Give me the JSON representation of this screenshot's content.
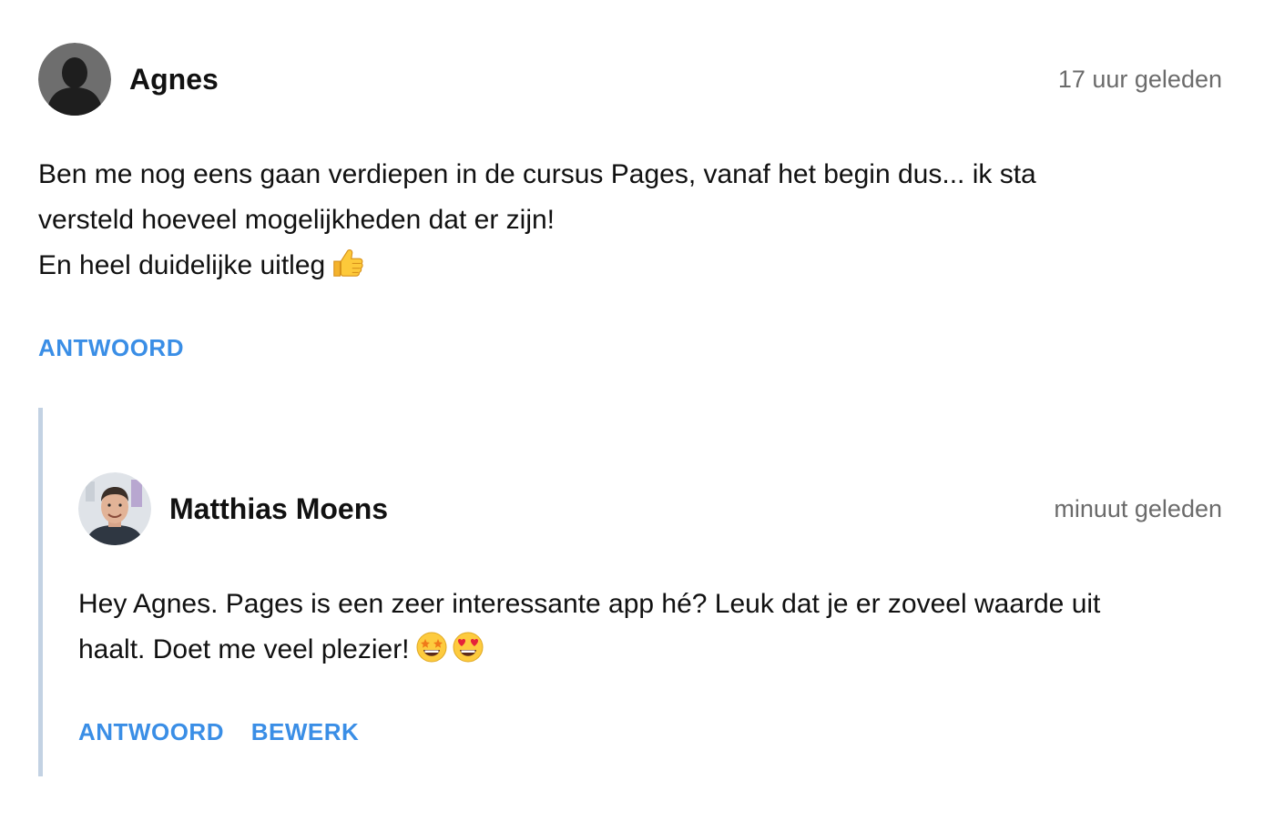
{
  "comments": [
    {
      "author": "Agnes",
      "time": "17 uur geleden",
      "lines": [
        "Ben me nog eens gaan verdiepen in de cursus Pages, vanaf het begin dus... ik sta",
        "versteld hoeveel mogelijkheden dat er zijn!",
        "En heel duidelijke uitleg"
      ],
      "emoji": [
        "thumbs-up-icon"
      ],
      "actions": {
        "reply": "ANTWOORD"
      }
    },
    {
      "author": "Matthias Moens",
      "time": "minuut geleden",
      "lines": [
        "Hey Agnes. Pages is een zeer interessante app hé? Leuk dat je er zoveel waarde uit",
        "haalt. Doet me veel plezier!"
      ],
      "emoji": [
        "star-struck-icon",
        "heart-eyes-icon"
      ],
      "actions": {
        "reply": "ANTWOORD",
        "edit": "BEWERK"
      }
    }
  ],
  "colors": {
    "action": "#3a8ee6",
    "thread_line": "#c3d2e3",
    "muted": "#6b6b6b"
  }
}
